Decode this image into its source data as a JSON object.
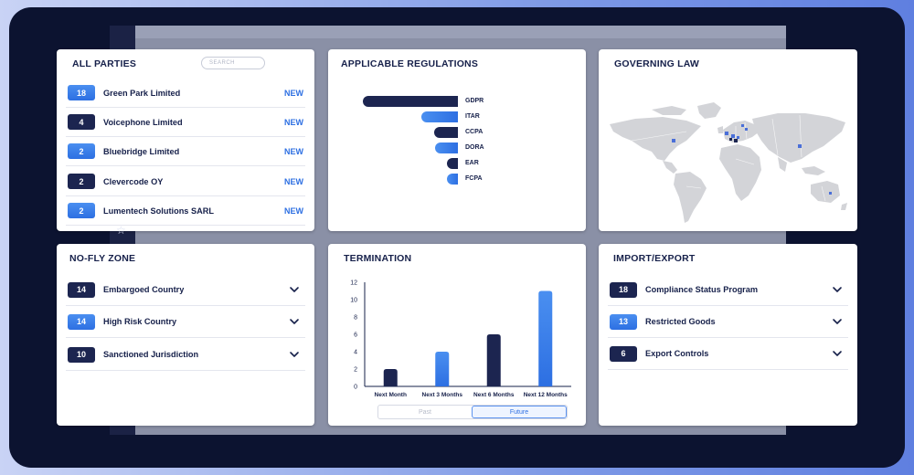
{
  "parties": {
    "title": "ALL PARTIES",
    "search_placeholder": "SEARCH",
    "items": [
      {
        "count": "18",
        "name": "Green Park Limited",
        "status": "NEW",
        "style": "blue"
      },
      {
        "count": "4",
        "name": "Voicephone Limited",
        "status": "NEW",
        "style": "navy"
      },
      {
        "count": "2",
        "name": "Bluebridge Limited",
        "status": "NEW",
        "style": "blue"
      },
      {
        "count": "2",
        "name": "Clevercode OY",
        "status": "NEW",
        "style": "navy"
      },
      {
        "count": "2",
        "name": "Lumentech Solutions SARL",
        "status": "NEW",
        "style": "blue"
      }
    ]
  },
  "regulations": {
    "title": "APPLICABLE REGULATIONS",
    "items": [
      {
        "label": "GDPR",
        "value": 1.0,
        "style": "navy"
      },
      {
        "label": "ITAR",
        "value": 0.38,
        "style": "blue"
      },
      {
        "label": "CCPA",
        "value": 0.25,
        "style": "navy"
      },
      {
        "label": "DORA",
        "value": 0.24,
        "style": "blue"
      },
      {
        "label": "EAR",
        "value": 0.12,
        "style": "navy"
      },
      {
        "label": "FCPA",
        "value": 0.12,
        "style": "blue"
      }
    ]
  },
  "governing_law": {
    "title": "GOVERNING LAW"
  },
  "nofly": {
    "title": "NO-FLY ZONE",
    "items": [
      {
        "count": "14",
        "name": "Embargoed Country",
        "style": "navy"
      },
      {
        "count": "14",
        "name": "High Risk Country",
        "style": "blue"
      },
      {
        "count": "10",
        "name": "Sanctioned Jurisdiction",
        "style": "navy"
      }
    ]
  },
  "termination": {
    "title": "TERMINATION",
    "toggle": {
      "past": "Past",
      "future": "Future",
      "selected": "Future"
    }
  },
  "import_export": {
    "title": "IMPORT/EXPORT",
    "items": [
      {
        "count": "18",
        "name": "Compliance Status Program",
        "style": "navy"
      },
      {
        "count": "13",
        "name": "Restricted Goods",
        "style": "blue"
      },
      {
        "count": "6",
        "name": "Export Controls",
        "style": "navy"
      }
    ]
  },
  "colors": {
    "navy": "#1c2550",
    "blue": "#2d6fe2",
    "blue_light": "#4a8ff0",
    "frame": "#0c1330"
  },
  "chart_data": {
    "type": "bar",
    "categories": [
      "Next Month",
      "Next 3 Months",
      "Next 6 Months",
      "Next 12 Months"
    ],
    "values": [
      2,
      4,
      6,
      11
    ],
    "styles": [
      "navy",
      "blue",
      "navy",
      "blue"
    ],
    "ylim": [
      0,
      12
    ],
    "yticks": [
      0,
      2,
      4,
      6,
      8,
      10,
      12
    ],
    "grid": false,
    "title": "",
    "xlabel": "",
    "ylabel": ""
  }
}
